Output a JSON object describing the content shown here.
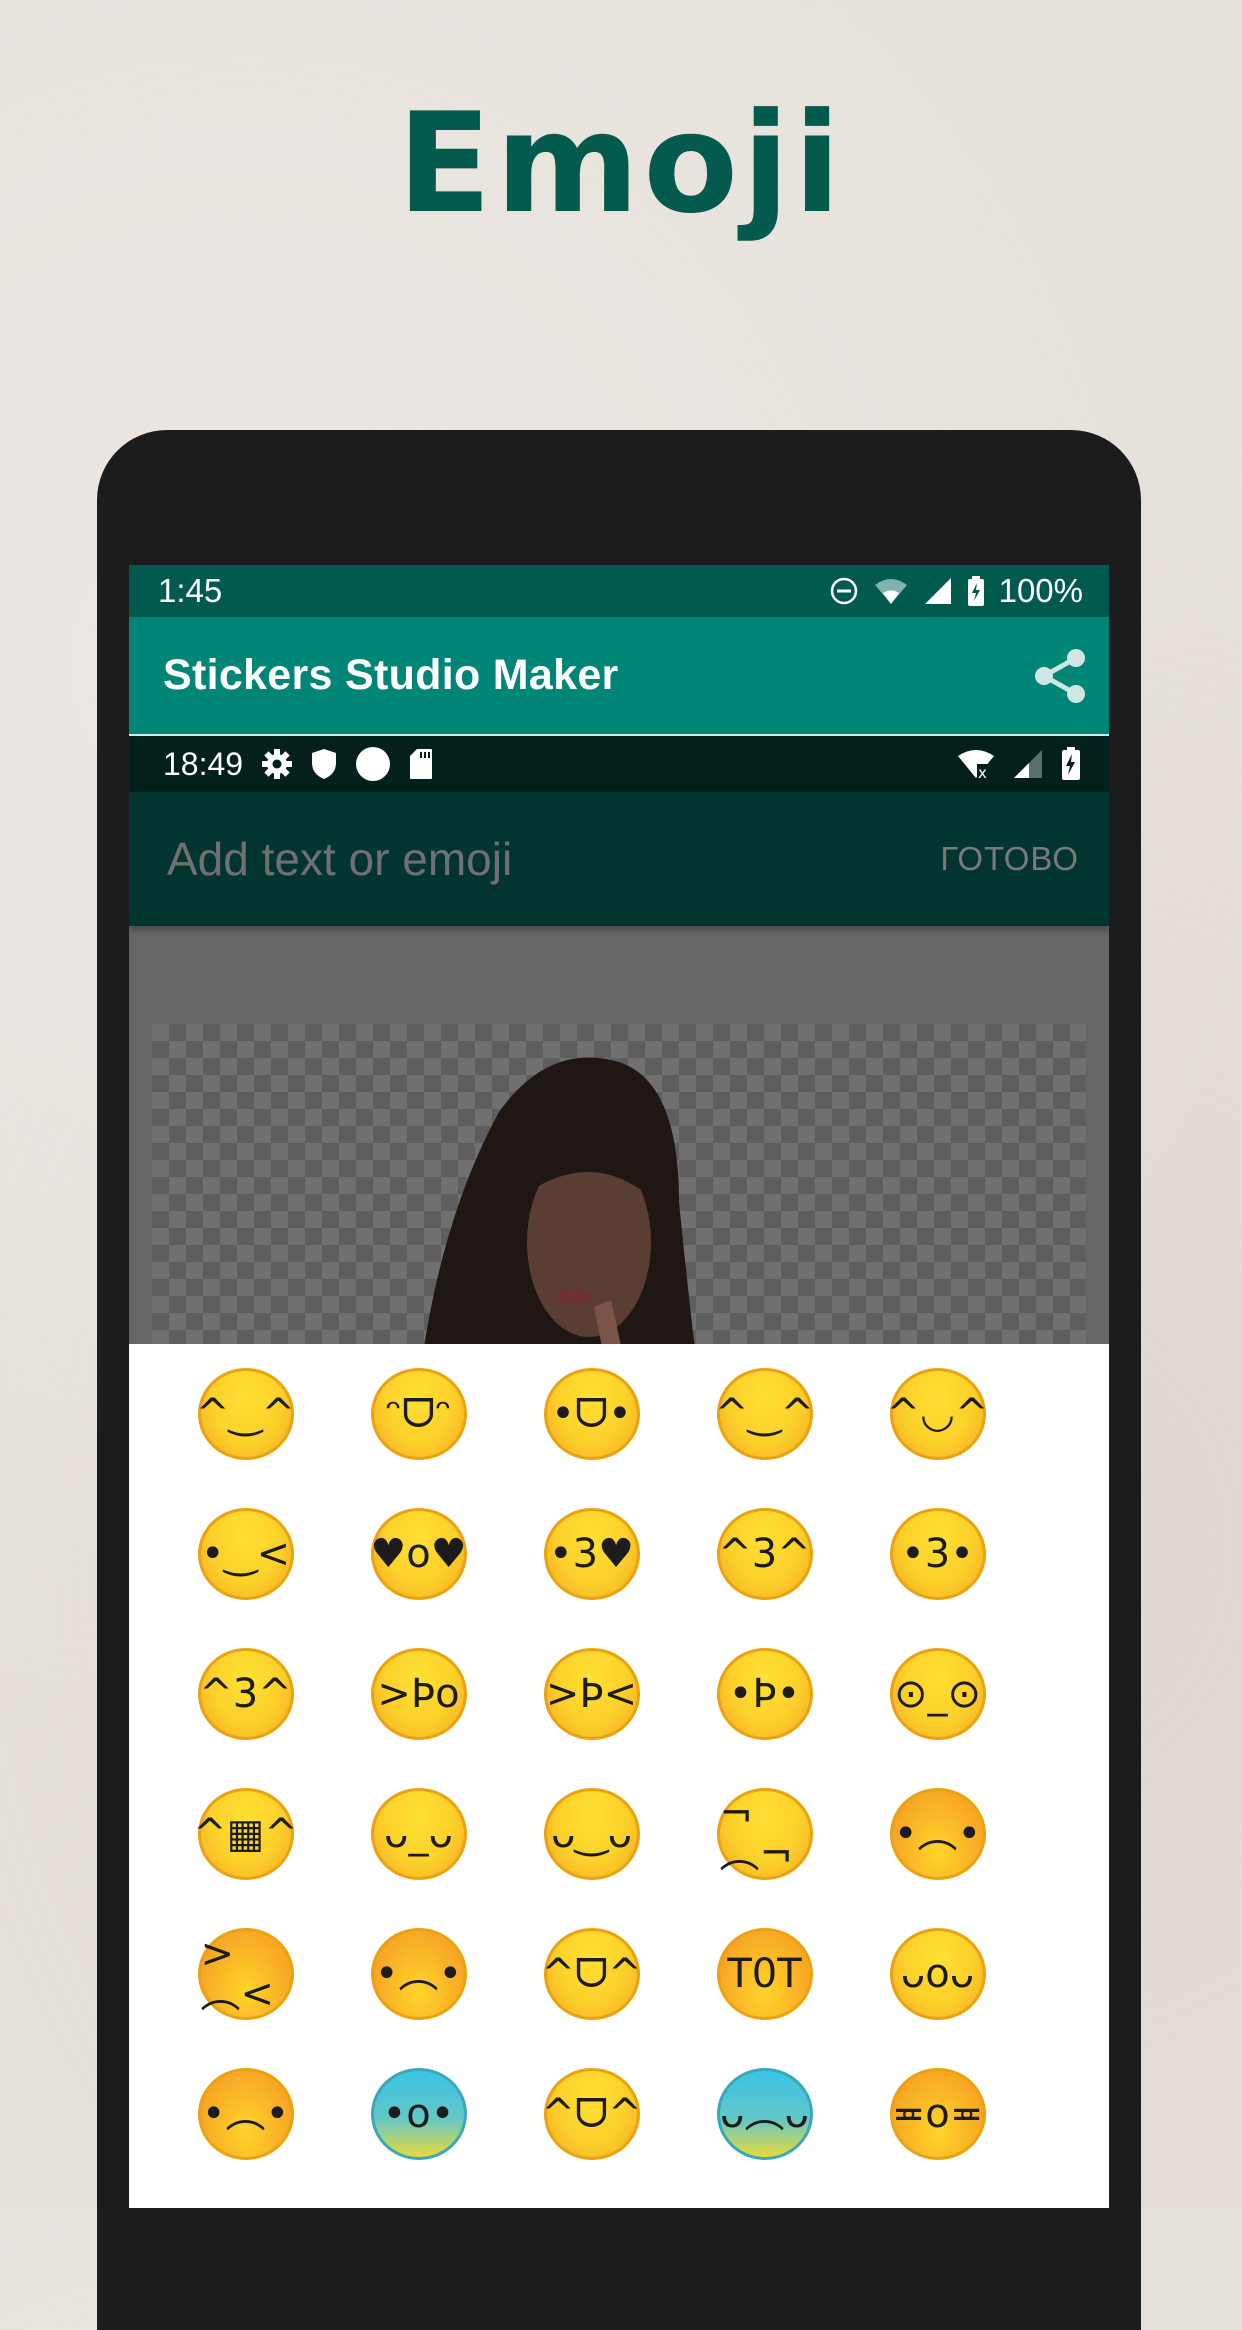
{
  "promo": {
    "title": "Emoji"
  },
  "device_status_bar": {
    "time": "1:45",
    "icons": [
      "do-not-disturb-icon",
      "wifi-icon",
      "signal-icon",
      "battery-charging-icon"
    ],
    "battery": "100%"
  },
  "app_bar": {
    "title": "Stickers Studio Maker",
    "share_icon": "share-icon"
  },
  "inner_status_bar": {
    "time": "18:49",
    "left_icons": [
      "gear-icon",
      "shield-icon",
      "circle-icon",
      "sd-card-icon"
    ],
    "right_icons": [
      "wifi-off-icon",
      "signal-icon",
      "battery-charging-icon"
    ]
  },
  "editor": {
    "input_placeholder": "Add text or emoji",
    "input_value": "",
    "done_label": "ГОТОВО"
  },
  "colors": {
    "status_bar": "#02594e",
    "app_bar": "#018577",
    "inner_status": "#03201c",
    "edit_bar": "#033530",
    "title": "#055a4e"
  },
  "emoji_grid": [
    [
      {
        "name": "grinning-squinting-open",
        "glyph": "^‿^"
      },
      {
        "name": "grinning-big-eyes",
        "glyph": "ᵔᗜᵔ"
      },
      {
        "name": "grinning-face",
        "glyph": "•ᗜ•"
      },
      {
        "name": "smiling-blush",
        "glyph": "^‿^"
      },
      {
        "name": "smiling-blush-small",
        "glyph": "^◡^"
      }
    ],
    [
      {
        "name": "winking-face",
        "glyph": "•‿<"
      },
      {
        "name": "heart-eyes",
        "glyph": "♥o♥"
      },
      {
        "name": "kissing-heart",
        "glyph": "•3♥"
      },
      {
        "name": "kissing-smiling-eyes",
        "glyph": "^3^"
      },
      {
        "name": "kissing-face",
        "glyph": "•3•"
      }
    ],
    [
      {
        "name": "kissing-closed-eyes",
        "glyph": "^3^"
      },
      {
        "name": "winking-tongue",
        "glyph": ">Þo"
      },
      {
        "name": "squinting-tongue",
        "glyph": ">Þ<"
      },
      {
        "name": "tongue-out",
        "glyph": "•Þ•"
      },
      {
        "name": "flushed-face",
        "glyph": "⊙_⊙"
      }
    ],
    [
      {
        "name": "beaming-grin",
        "glyph": "^▦^"
      },
      {
        "name": "pensive-face",
        "glyph": "ᴗ_ᴗ"
      },
      {
        "name": "relieved-face",
        "glyph": "ᴗ‿ᴗ"
      },
      {
        "name": "unamused-face",
        "glyph": "¬︵¬"
      },
      {
        "name": "worried-face",
        "glyph": "•︵•"
      }
    ],
    [
      {
        "name": "tired-face",
        "glyph": ">︵<"
      },
      {
        "name": "crying-face",
        "glyph": "•︵•"
      },
      {
        "name": "tears-of-joy",
        "glyph": "^ᗜ^"
      },
      {
        "name": "loudly-crying",
        "glyph": "T0T"
      },
      {
        "name": "sleepy-face",
        "glyph": "ᴗoᴗ"
      }
    ],
    [
      {
        "name": "sad-sweat",
        "glyph": "•︵•"
      },
      {
        "name": "anxious-sweat",
        "glyph": "•o•"
      },
      {
        "name": "grinning-sweat",
        "glyph": "^ᗜ^"
      },
      {
        "name": "downcast-sweat",
        "glyph": "ᴗ︵ᴗ"
      },
      {
        "name": "weary-face",
        "glyph": "≖o≖"
      }
    ]
  ]
}
